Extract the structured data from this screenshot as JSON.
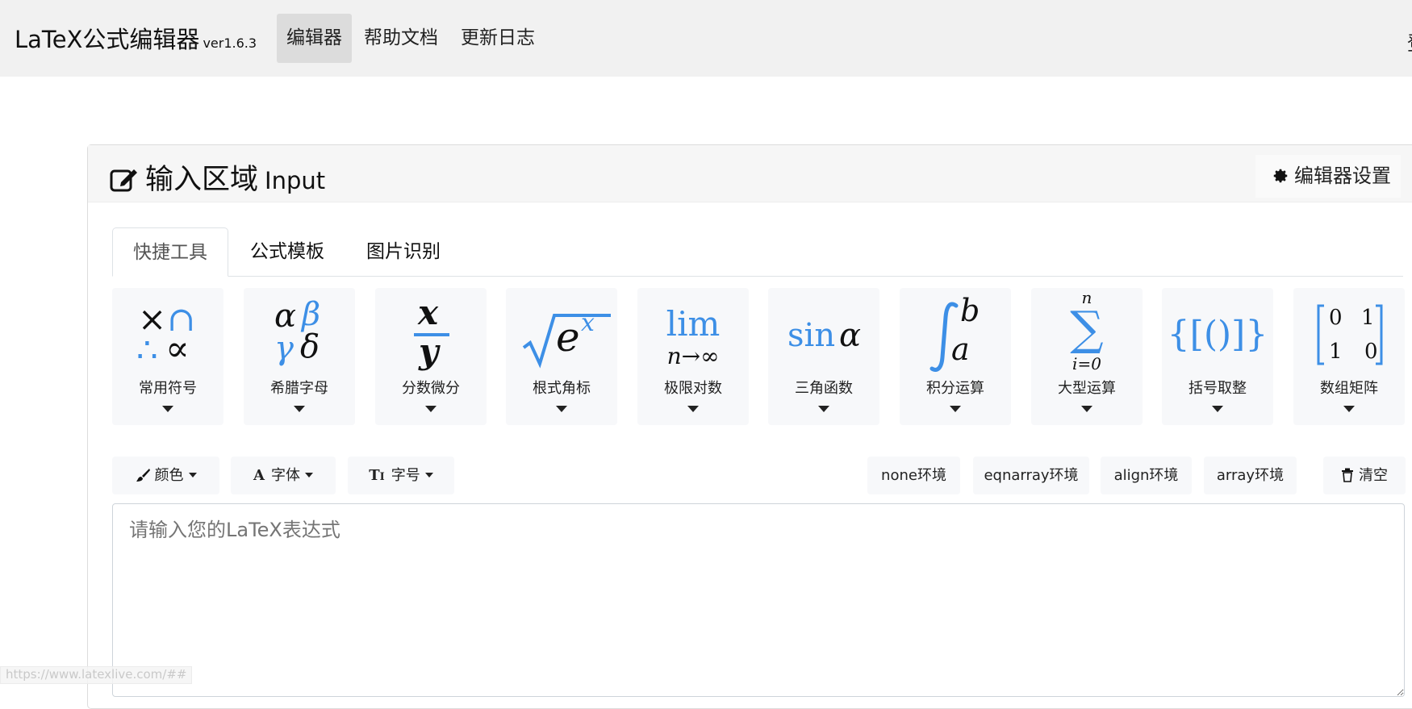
{
  "navbar": {
    "brand": "LaTeX公式编辑器",
    "version": "ver1.6.3",
    "items": [
      {
        "label": "编辑器",
        "active": true
      },
      {
        "label": "帮助文档",
        "active": false
      },
      {
        "label": "更新日志",
        "active": false
      }
    ],
    "cut_item": "登"
  },
  "card": {
    "title": "输入区域",
    "title_en": "Input",
    "settings_label": "编辑器设置"
  },
  "tabs": [
    {
      "label": "快捷工具",
      "active": true
    },
    {
      "label": "公式模板",
      "active": false
    },
    {
      "label": "图片识别",
      "active": false
    }
  ],
  "tools": [
    {
      "label": "常用符号",
      "icon": "common-symbols-icon"
    },
    {
      "label": "希腊字母",
      "icon": "greek-letters-icon"
    },
    {
      "label": "分数微分",
      "icon": "fraction-icon"
    },
    {
      "label": "根式角标",
      "icon": "radical-icon"
    },
    {
      "label": "极限对数",
      "icon": "limit-icon"
    },
    {
      "label": "三角函数",
      "icon": "trig-icon"
    },
    {
      "label": "积分运算",
      "icon": "integral-icon"
    },
    {
      "label": "大型运算",
      "icon": "sum-icon"
    },
    {
      "label": "括号取整",
      "icon": "brackets-icon"
    },
    {
      "label": "数组矩阵",
      "icon": "matrix-icon"
    }
  ],
  "tool_symbols": {
    "frac_num": "x",
    "frac_den": "y",
    "sqrt_base": "e",
    "sqrt_exp": "x",
    "lim_word": "lim",
    "lim_sub": "n→∞",
    "sin_word": "sin",
    "sin_var": "α",
    "int_upper": "b",
    "int_lower": "a",
    "sum_upper": "n",
    "sum_lower": "i=0",
    "brackets": "{[()]}",
    "matrix": [
      "0",
      "1",
      "1",
      "0"
    ],
    "greek": [
      "α",
      "β",
      "γ",
      "δ"
    ],
    "common": [
      "×",
      "∩",
      "∴",
      "∝"
    ]
  },
  "toolbar": {
    "color_label": "颜色",
    "font_label": "字体",
    "size_label": "字号",
    "env_none": "none环境",
    "env_eqnarray": "eqnarray环境",
    "env_align": "align环境",
    "env_array": "array环境",
    "clear_label": "清空"
  },
  "editor": {
    "placeholder": "请输入您的LaTeX表达式",
    "value": ""
  },
  "status_url": "https://www.latexlive.com/##",
  "colors": {
    "accent_blue": "#3d8fe6",
    "navbar_bg": "#f1f1f1",
    "tool_bg": "#f7f8fa"
  }
}
